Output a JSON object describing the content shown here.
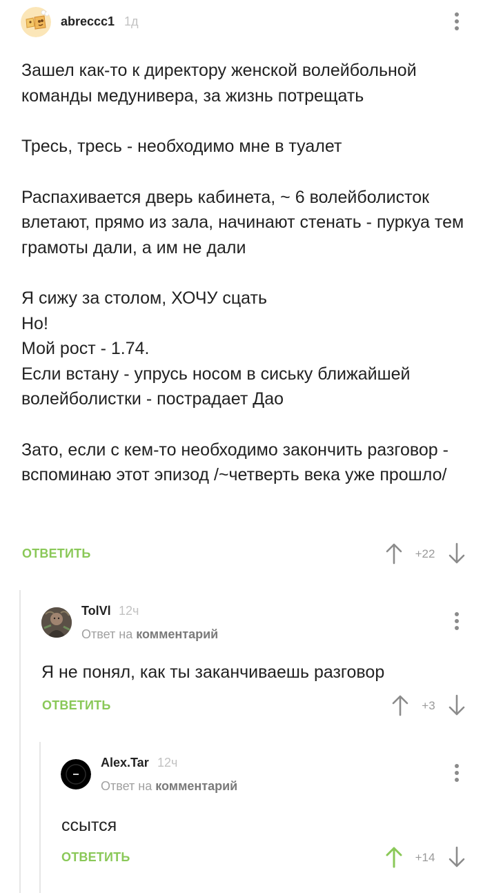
{
  "comments": [
    {
      "author": "abreccc1",
      "time": "1д",
      "lines": [
        "Зашел как-то к директору женской волейбольной команды медунивера, за жизнь потрещать",
        "Тресь, тресь - необходимо мне в туалет",
        "Распахивается дверь кабинета, ~ 6 волейболисток влетают, прямо из зала, начинают стенать - пуркуа тем грамоты дали, а им не дали",
        "Я сижу за столом, ХОЧУ сцать\nНо!\nМой рост - 1.74.\nЕсли встану - упрусь носом в сиську ближайшей волейболистки - пострадает Дао",
        "Зато, если с кем-то необходимо закончить разговор - вспоминаю этот эпизод /~четверть века уже прошло/"
      ],
      "reply_label": "ОТВЕТИТЬ",
      "rating": "+22"
    },
    {
      "author": "TolVl",
      "time": "12ч",
      "reply_prefix": "Ответ на",
      "reply_target": "комментарий",
      "text": "Я не понял, как ты заканчиваешь разговор",
      "reply_label": "ОТВЕТИТЬ",
      "rating": "+3"
    },
    {
      "author": "Alex.Tar",
      "time": "12ч",
      "reply_prefix": "Ответ на",
      "reply_target": "комментарий",
      "text": "ссытся",
      "reply_label": "ОТВЕТИТЬ",
      "rating": "+14",
      "upvoted": true
    }
  ],
  "icons": {
    "more": "more-vertical-icon",
    "upvote": "arrow-up-icon",
    "downvote": "arrow-down-icon"
  },
  "colors": {
    "accent": "#8ac858",
    "vote_inactive": "#8b8b8b",
    "muted_text": "#a0a0a0",
    "thread_line": "#e6e6e6"
  }
}
